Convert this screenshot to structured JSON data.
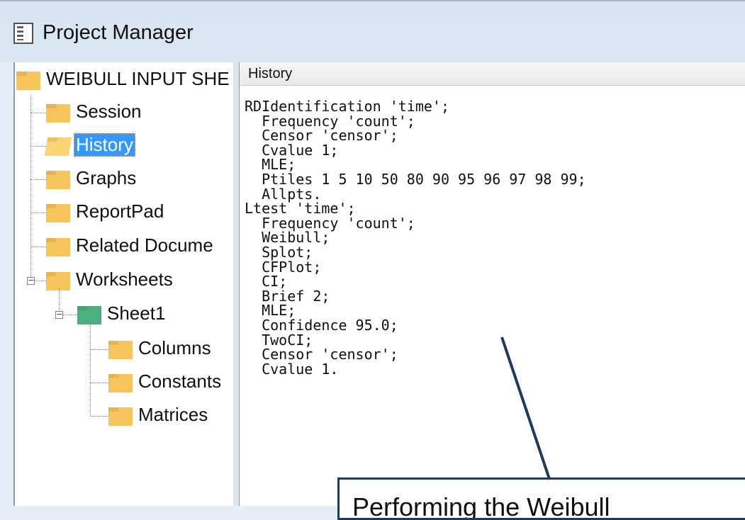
{
  "window": {
    "title": "Project Manager"
  },
  "tree": {
    "root": {
      "label": "WEIBULL INPUT SHE"
    },
    "items": [
      {
        "label": "Session"
      },
      {
        "label": "History"
      },
      {
        "label": "Graphs"
      },
      {
        "label": "ReportPad"
      },
      {
        "label": "Related Docume"
      },
      {
        "label": "Worksheets"
      }
    ],
    "sheet": {
      "label": "Sheet1"
    },
    "sheet_children": [
      {
        "label": "Columns"
      },
      {
        "label": "Constants"
      },
      {
        "label": "Matrices"
      }
    ],
    "selected": "History"
  },
  "history": {
    "header": "History",
    "lines": [
      "RDIdentification 'time';",
      "  Frequency 'count';",
      "  Censor 'censor';",
      "  Cvalue 1;",
      "  MLE;",
      "  Ptiles 1 5 10 50 80 90 95 96 97 98 99;",
      "  Allpts.",
      "Ltest 'time';",
      "  Frequency 'count';",
      "  Weibull;",
      "  Splot;",
      "  CFPlot;",
      "  CI;",
      "  Brief 2;",
      "  MLE;",
      "  Confidence 95.0;",
      "  TwoCI;",
      "  Censor 'censor';",
      "  Cvalue 1."
    ]
  },
  "callout": {
    "text": "Performing the Weibull"
  },
  "colors": {
    "selection": "#3399ff",
    "folder": "#f8c45c",
    "sheet_icon": "#4caf82",
    "callout_border": "#1e3a5f"
  }
}
